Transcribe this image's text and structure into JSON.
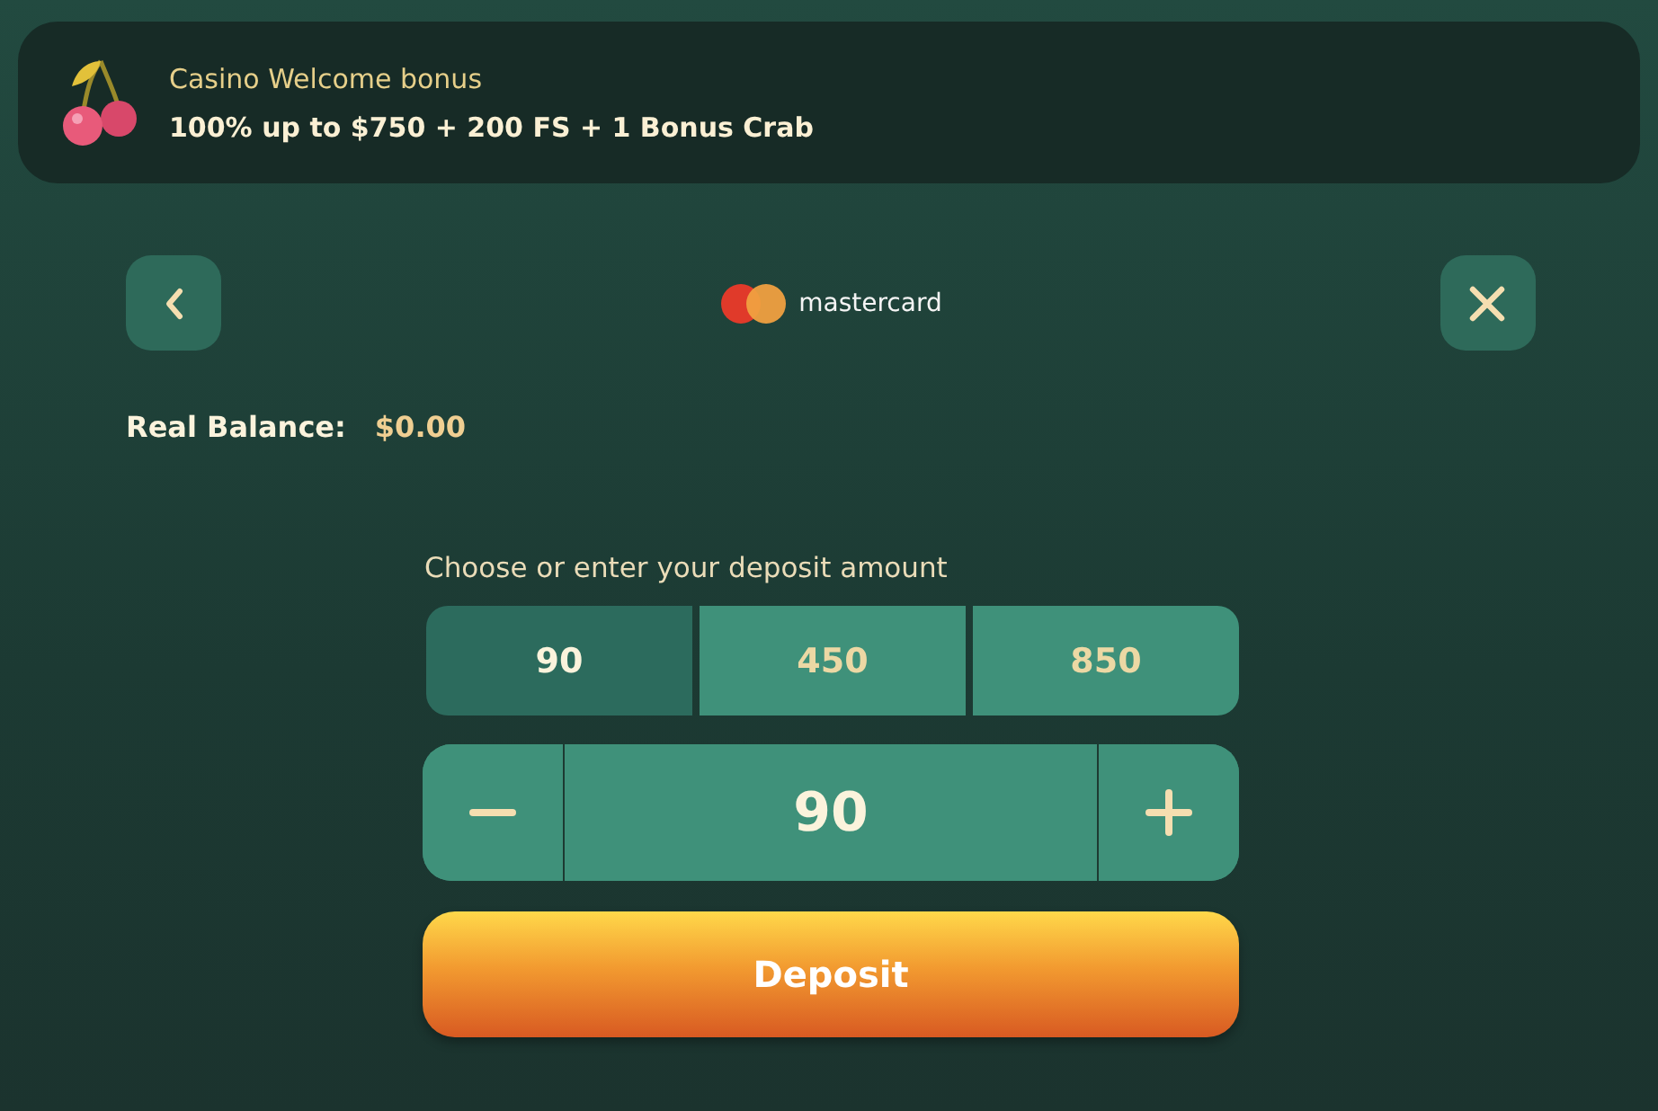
{
  "banner": {
    "title": "Casino Welcome bonus",
    "offer": "100% up to $750 + 200 FS + 1 Bonus Crab"
  },
  "header": {
    "method": "mastercard"
  },
  "balance": {
    "label": "Real Balance:",
    "value": "$0.00"
  },
  "deposit": {
    "prompt": "Choose or enter your deposit amount",
    "amounts": [
      {
        "label": "90",
        "selected": true
      },
      {
        "label": "450",
        "selected": false
      },
      {
        "label": "850",
        "selected": false
      }
    ],
    "value": "90",
    "button": "Deposit"
  }
}
